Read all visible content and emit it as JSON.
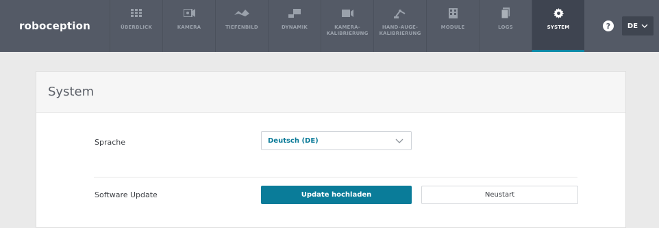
{
  "brand": "roboception",
  "nav": {
    "items": [
      {
        "label": "ÜBERBLICK",
        "icon": "grid-icon"
      },
      {
        "label": "KAMERA",
        "icon": "camera-icon"
      },
      {
        "label": "TIEFENBILD",
        "icon": "depth-icon"
      },
      {
        "label": "DYNAMIK",
        "icon": "dynamics-icon"
      },
      {
        "label": "KAMERA-\nKALIBRIERUNG",
        "icon": "camera-calibration-icon"
      },
      {
        "label": "HAND-AUGE-\nKALIBRIERUNG",
        "icon": "robot-arm-icon"
      },
      {
        "label": "MODULE",
        "icon": "modules-icon"
      },
      {
        "label": "LOGS",
        "icon": "logs-icon"
      },
      {
        "label": "SYSTEM",
        "icon": "gear-icon"
      }
    ],
    "active": "SYSTEM",
    "help_symbol": "?",
    "language": "DE"
  },
  "card": {
    "title": "System",
    "language_label": "Sprache",
    "language_value": "Deutsch (DE)",
    "update_label": "Software Update",
    "upload_button": "Update hochladen",
    "restart_button": "Neustart"
  },
  "colors": {
    "navbar": "#545a66",
    "active_nav": "#3e4450",
    "accent": "#0a7c99"
  }
}
